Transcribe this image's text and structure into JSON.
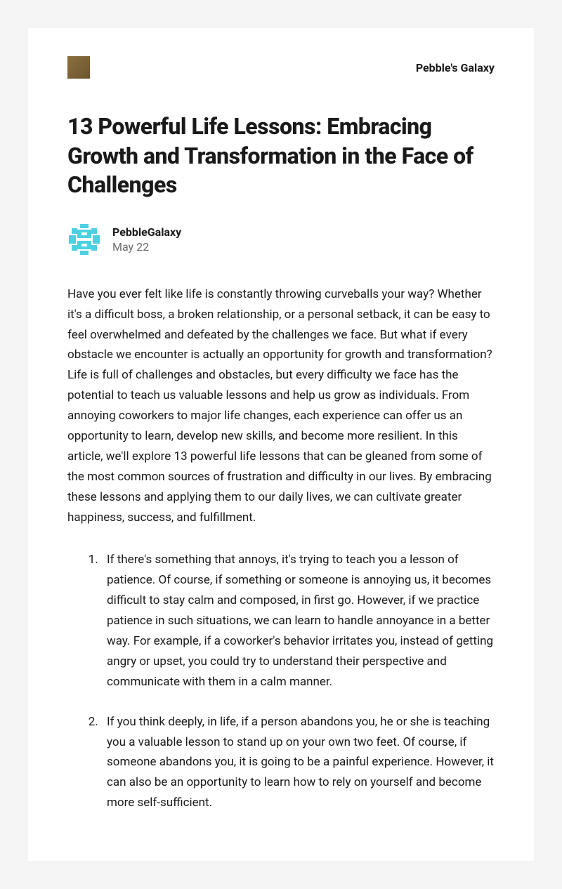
{
  "header": {
    "site_name": "Pebble's Galaxy"
  },
  "post": {
    "title": "13 Powerful Life Lessons: Embracing Growth and Transformation in the Face of Challenges",
    "author": "PebbleGalaxy",
    "date": "May 22",
    "intro": "Have you ever felt like life is constantly throwing curveballs your way? Whether it's a difficult boss, a broken relationship, or a personal setback, it can be easy to feel overwhelmed and defeated by the challenges we face. But what if every obstacle we encounter is actually an opportunity for growth and transformation? Life is full of challenges and obstacles, but every difficulty we face has the potential to teach us valuable lessons and help us grow as individuals. From annoying coworkers to major life changes, each experience can offer us an opportunity to learn, develop new skills, and become more resilient. In this article, we'll explore 13 powerful life lessons that can be gleaned from some of the most common sources of frustration and difficulty in our lives. By embracing these lessons and applying them to our daily lives, we can cultivate greater happiness, success, and fulfillment.",
    "lessons": [
      "If there's something that annoys, it's trying to teach you a lesson of patience. Of course, if something or someone is annoying us, it becomes difficult to stay calm and composed, in first go. However, if we practice patience in such situations, we can learn to handle annoyance in a better way. For example, if a coworker's behavior irritates you, instead of getting angry or upset, you could try to understand their perspective and communicate with them in a calm manner.",
      "If you think deeply, in life, if a person abandons you, he or she is teaching you a valuable lesson to stand up on your own two feet. Of course, if someone abandons you, it is going to be a painful experience. However, it can also be an opportunity to learn how to rely on yourself and become more self-sufficient."
    ]
  }
}
